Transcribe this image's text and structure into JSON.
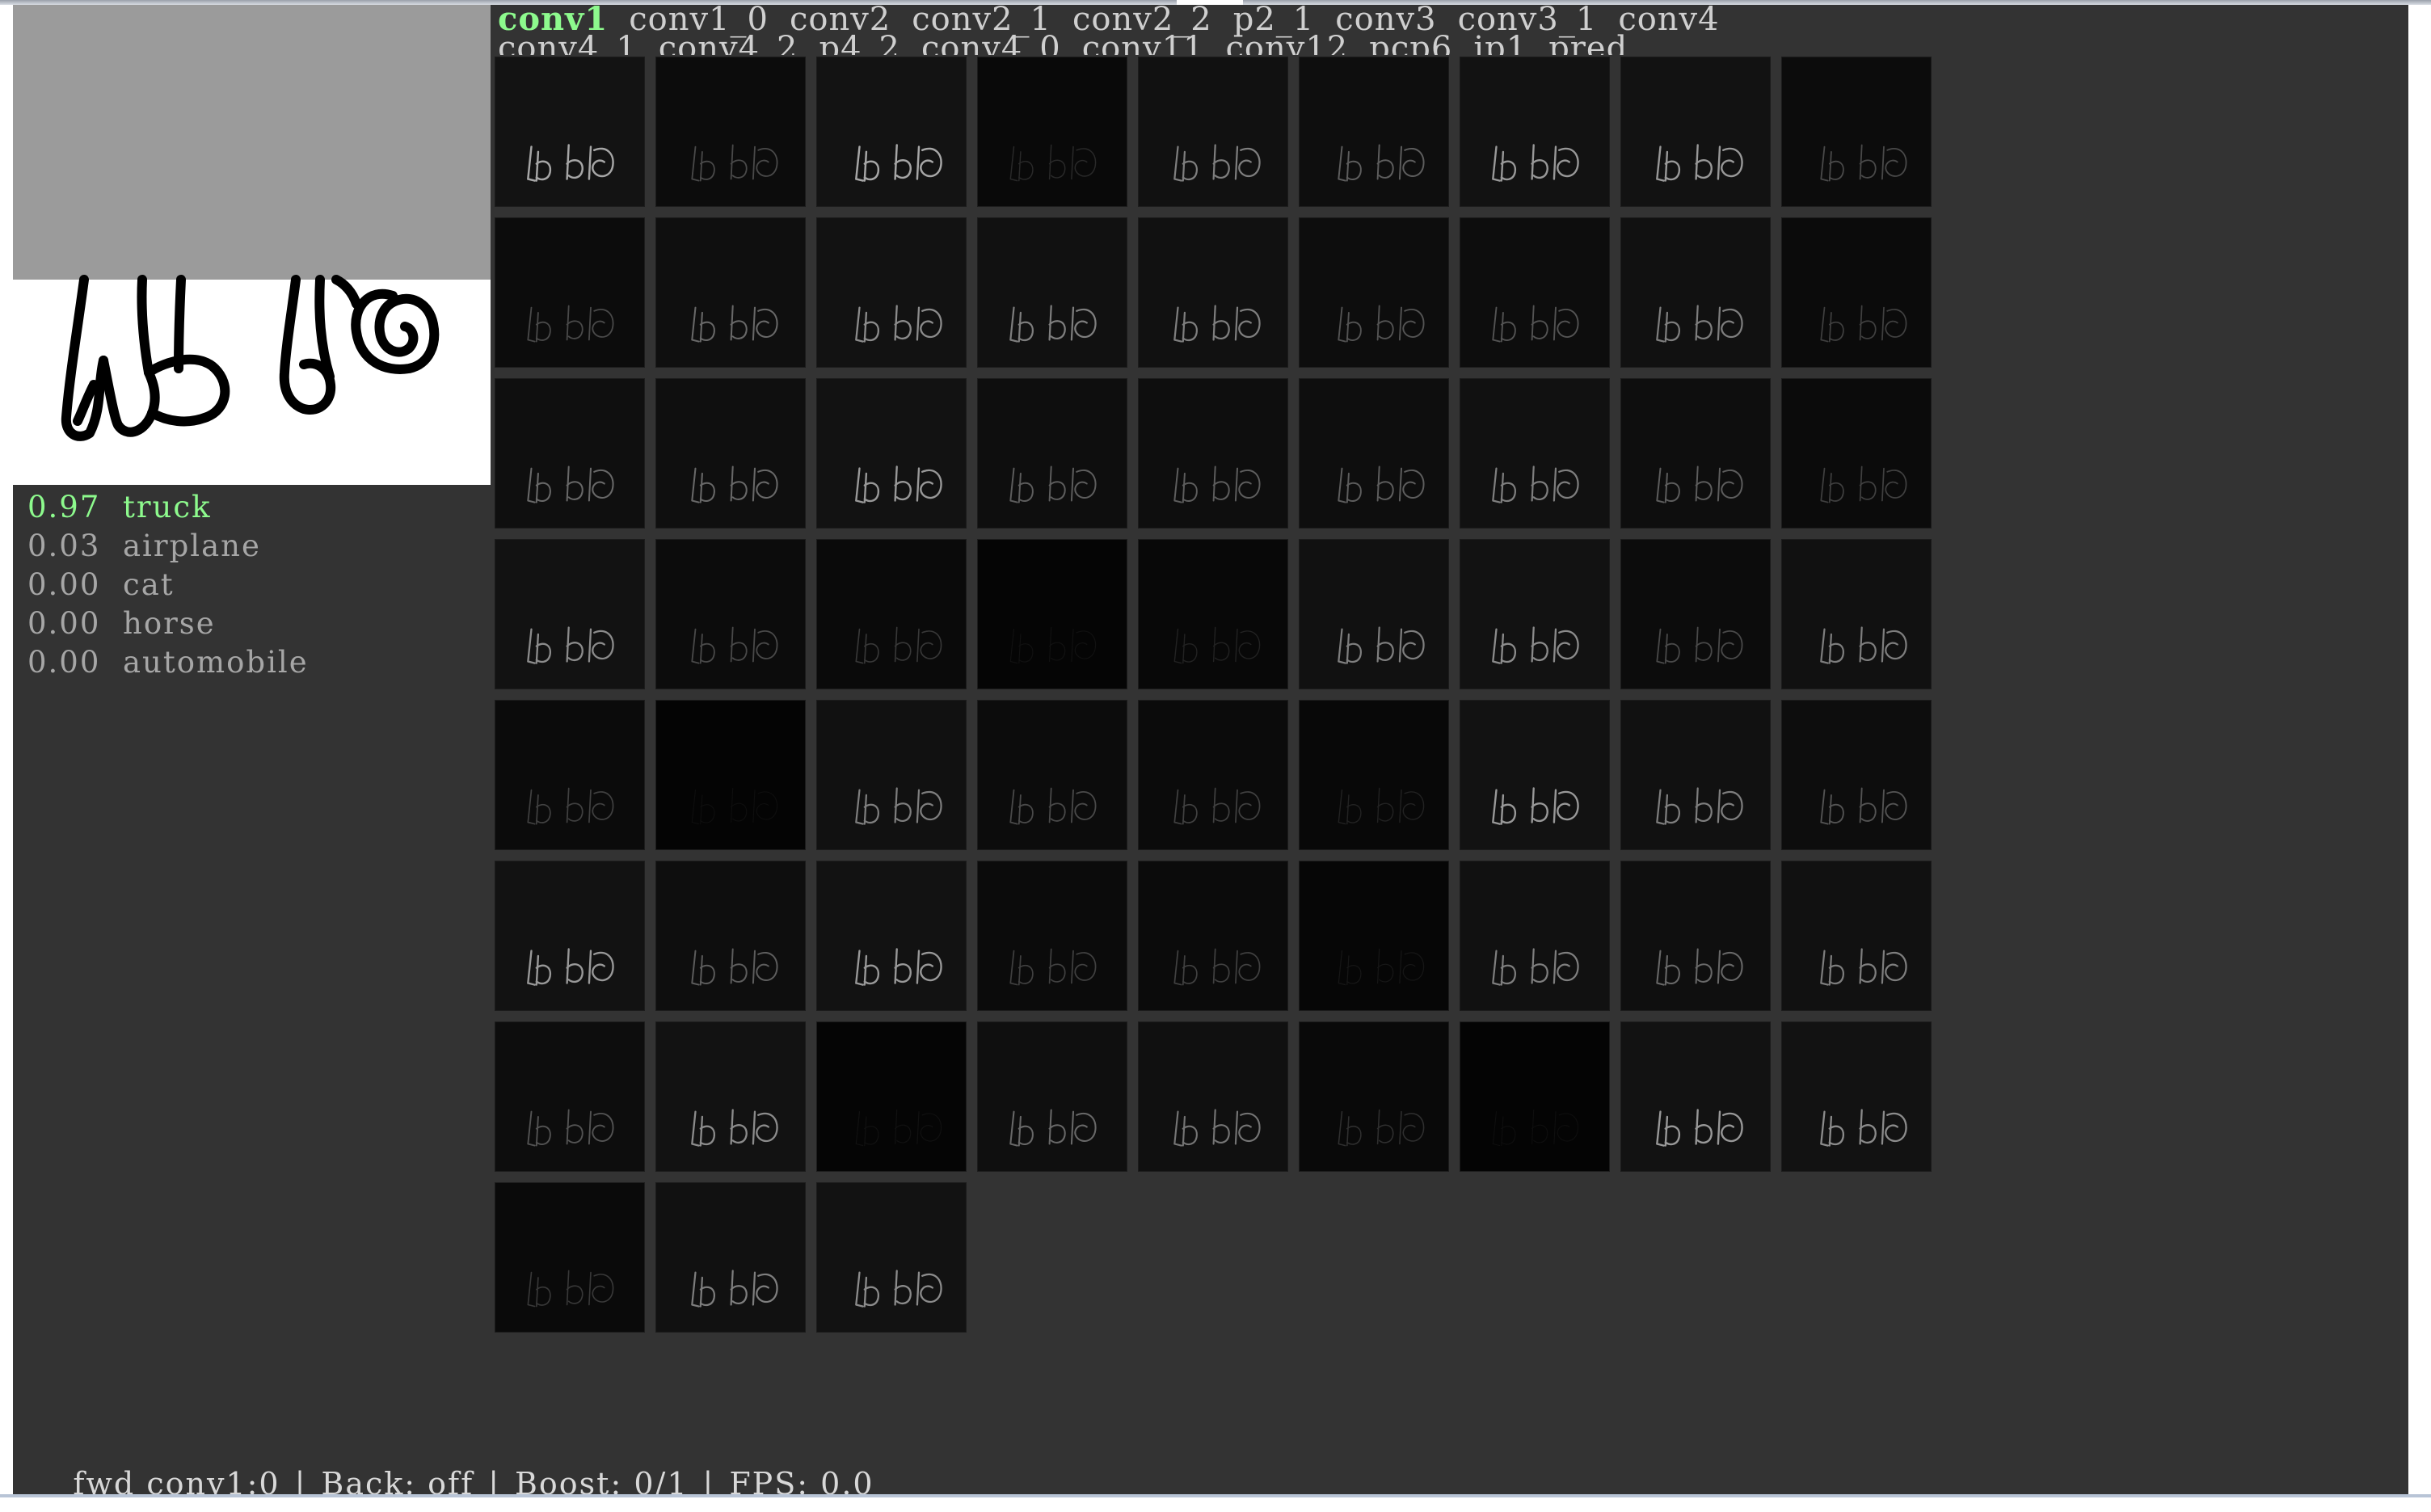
{
  "layers": [
    {
      "label": "conv1",
      "active": true
    },
    {
      "label": "conv1_0",
      "active": false
    },
    {
      "label": "conv2",
      "active": false
    },
    {
      "label": "conv2_1",
      "active": false
    },
    {
      "label": "conv2_2",
      "active": false
    },
    {
      "label": "p2_1",
      "active": false
    },
    {
      "label": "conv3",
      "active": false
    },
    {
      "label": "conv3_1",
      "active": false
    },
    {
      "label": "conv4",
      "active": false
    },
    {
      "label": "conv4_1",
      "active": false
    },
    {
      "label": "conv4_2",
      "active": false
    },
    {
      "label": "p4_2",
      "active": false
    },
    {
      "label": "conv4_0",
      "active": false
    },
    {
      "label": "conv11",
      "active": false
    },
    {
      "label": "conv12",
      "active": false
    },
    {
      "label": "pcp6",
      "active": false
    },
    {
      "label": "ip1",
      "active": false
    },
    {
      "label": "pred",
      "active": false
    }
  ],
  "predictions": [
    {
      "score": "0.97",
      "label": "truck",
      "top": true
    },
    {
      "score": "0.03",
      "label": "airplane",
      "top": false
    },
    {
      "score": "0.00",
      "label": "cat",
      "top": false
    },
    {
      "score": "0.00",
      "label": "horse",
      "top": false
    },
    {
      "score": "0.00",
      "label": "automobile",
      "top": false
    }
  ],
  "activation_tiles": [
    0.85,
    0.45,
    0.85,
    0.25,
    0.7,
    0.55,
    0.8,
    0.8,
    0.45,
    0.45,
    0.6,
    0.75,
    0.7,
    0.7,
    0.5,
    0.5,
    0.7,
    0.4,
    0.6,
    0.6,
    0.8,
    0.55,
    0.55,
    0.55,
    0.7,
    0.55,
    0.4,
    0.75,
    0.45,
    0.35,
    0.05,
    0.2,
    0.7,
    0.75,
    0.45,
    0.7,
    0.4,
    0.02,
    0.7,
    0.45,
    0.4,
    0.2,
    0.8,
    0.7,
    0.5,
    0.8,
    0.55,
    0.8,
    0.4,
    0.4,
    0.1,
    0.7,
    0.6,
    0.7,
    0.5,
    0.75,
    0.05,
    0.6,
    0.65,
    0.3,
    0.02,
    0.8,
    0.75,
    0.35,
    0.7,
    0.75
  ],
  "status": {
    "mode": "fwd conv1:0",
    "back": "Back: off",
    "boost": "Boost: 0/1",
    "fps": "FPS: 0.0"
  }
}
